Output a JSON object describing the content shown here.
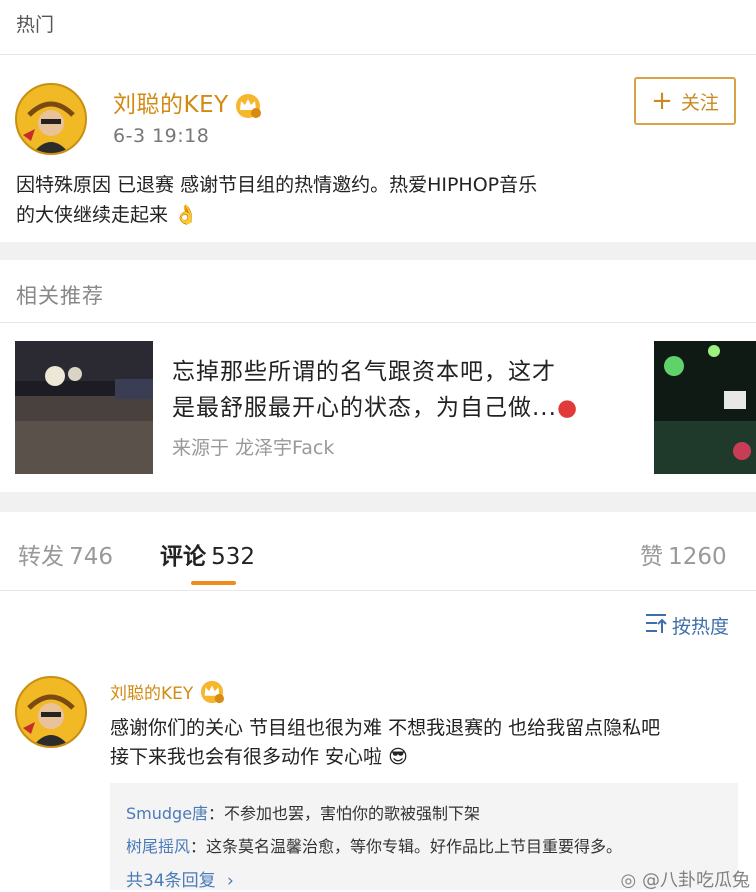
{
  "header": {
    "title": "热门"
  },
  "post": {
    "author": "刘聪的KEY",
    "time": "6-3 19:18",
    "follow_label": "关注",
    "follow_icon": "plus-icon",
    "text_line1": "因特殊原因 已退赛 感谢节目组的热情邀约。热爱HIPHOP音乐",
    "text_line2": "的大侠继续走起来",
    "emoji": "👌"
  },
  "recommend": {
    "section_title": "相关推荐",
    "title_line1": "忘掉那些所谓的名气跟资本吧，这才",
    "title_line2": "是最舒服最开心的状态，为自己做...",
    "source": "来源于 龙泽宇Fack"
  },
  "tabs": {
    "repost_label": "转发",
    "repost_count": "746",
    "comment_label": "评论",
    "comment_count": "532",
    "like_label": "赞",
    "like_count": "1260"
  },
  "sort": {
    "label": "按热度",
    "icon": "sort-icon"
  },
  "comment": {
    "author": "刘聪的KEY",
    "text_line1": "感谢你们的关心 节目组也很为难 不想我退赛的 也给我留点隐私吧",
    "text_line2": "接下来我也会有很多动作 安心啦",
    "emoji": "😎",
    "replies": [
      {
        "who": "Smudge唐",
        "text": "：不参加也罢，害怕你的歌被强制下架"
      },
      {
        "who": "树尾摇风",
        "text": "：这条莫名温馨治愈，等你专辑。好作品比上节目重要得多。"
      }
    ],
    "more_replies": "共34条回复"
  },
  "watermark": "@八卦吃瓜兔",
  "colors": {
    "accent_orange": "#f08c1b",
    "author_gold": "#d28a12",
    "link_blue": "#4a7ab8"
  }
}
